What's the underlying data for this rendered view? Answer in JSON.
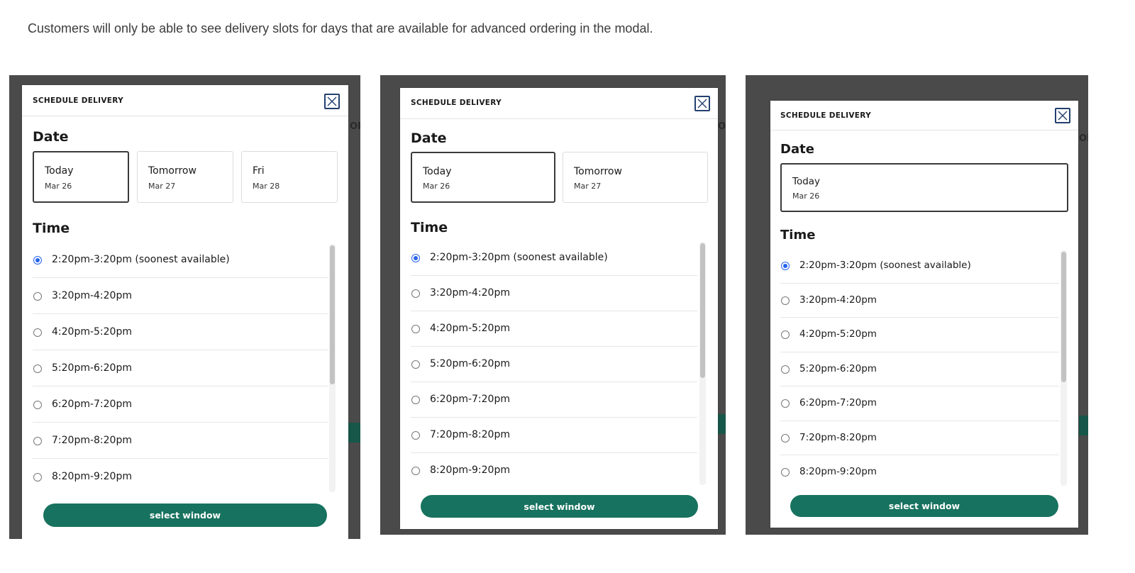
{
  "caption": "Customers will only be able to see delivery slots for days that are available for advanced ordering in the modal.",
  "modal": {
    "title": "SCHEDULE DELIVERY",
    "date_label": "Date",
    "time_label": "Time",
    "cta_label": "select window"
  },
  "dates": [
    {
      "day": "Today",
      "date": "Mar 26"
    },
    {
      "day": "Tomorrow",
      "date": "Mar 27"
    },
    {
      "day": "Fri",
      "date": "Mar 28"
    }
  ],
  "slots": [
    "2:20pm-3:20pm (soonest available)",
    "3:20pm-4:20pm",
    "4:20pm-5:20pm",
    "5:20pm-6:20pm",
    "6:20pm-7:20pm",
    "7:20pm-8:20pm",
    "8:20pm-9:20pm"
  ],
  "selected_slot_index": 0,
  "selected_date_index": 0,
  "panels": [
    {
      "dates_available": 3
    },
    {
      "dates_available": 2
    },
    {
      "dates_available": 1
    }
  ],
  "colors": {
    "cta": "#17725f",
    "radio_selected": "#2563eb",
    "close_border": "#23406f",
    "backdrop": "#4a4a4a"
  },
  "icons": {
    "close": "close-icon"
  }
}
